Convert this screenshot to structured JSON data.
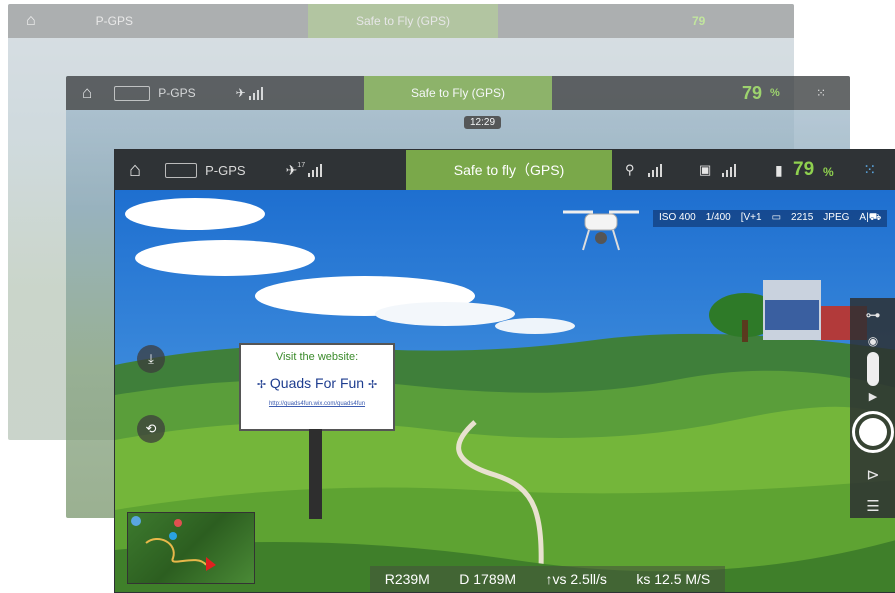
{
  "app": {
    "home_icon": "home-icon",
    "mode_icon": "flight-mode-icon",
    "mode": "P-GPS",
    "satellite_count": "17",
    "safety_status": "Safe to fly（GPS)",
    "safety_status_back": "Safe to Fly (GPS)",
    "back_mode": "P-GPS",
    "battery_percent": "79",
    "battery_unit": "%",
    "flight_time": "12:29",
    "colors": {
      "accent": "#7aa84a",
      "bar": "#2f3336",
      "battery": "#8fd14f"
    }
  },
  "camera_params": {
    "iso": "ISO 400",
    "shutter": "1/400",
    "ev": "[V+1",
    "storage": "2215",
    "format": "JPEG",
    "mode": "A|⛟"
  },
  "billboard": {
    "line1": "Visit the website:",
    "line2": "Quads For Fun",
    "line3": "http://quads4fun.wix.com/quads4fun"
  },
  "telemetry": {
    "range": "R239M",
    "distance": "D 1789M",
    "vertical_speed": "vs 2.5ll/s",
    "horizontal_speed": "ks 12.5 M/S"
  },
  "right_panel": {
    "settings_icon": "camera-settings-icon",
    "photo_icon": "photo-mode-icon",
    "video_icon": "video-mode-icon",
    "shutter_icon": "shutter-button-icon",
    "playback_icon": "playback-icon",
    "sliders_icon": "adjust-sliders-icon"
  }
}
